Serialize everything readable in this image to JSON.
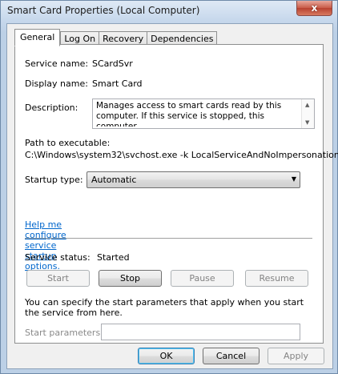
{
  "window": {
    "title": "Smart Card Properties (Local Computer)",
    "close_symbol": "x"
  },
  "tabs": [
    {
      "label": "General",
      "active": true
    },
    {
      "label": "Log On",
      "active": false
    },
    {
      "label": "Recovery",
      "active": false
    },
    {
      "label": "Dependencies",
      "active": false
    }
  ],
  "general": {
    "service_name_label": "Service name:",
    "service_name_value": "SCardSvr",
    "display_name_label": "Display name:",
    "display_name_value": "Smart Card",
    "description_label": "Description:",
    "description_value": "Manages access to smart cards read by this computer. If this service is stopped, this computer",
    "path_label": "Path to executable:",
    "path_value": "C:\\Windows\\system32\\svchost.exe -k LocalServiceAndNoImpersonation",
    "startup_type_label": "Startup type:",
    "startup_type_value": "Automatic",
    "help_link": "Help me configure service startup options.",
    "status_label": "Service status:",
    "status_value": "Started",
    "start_label": "Start",
    "stop_label": "Stop",
    "pause_label": "Pause",
    "resume_label": "Resume",
    "params_info": "You can specify the start parameters that apply when you start the service from here.",
    "params_label": "Start parameters:",
    "params_value": ""
  },
  "footer": {
    "ok_label": "OK",
    "cancel_label": "Cancel",
    "apply_label": "Apply"
  }
}
